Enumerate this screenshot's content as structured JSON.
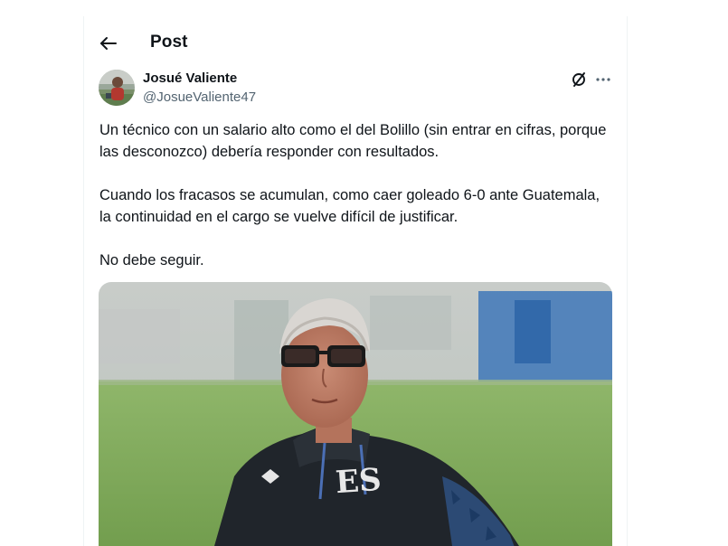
{
  "header": {
    "back_icon": "arrow-left-icon",
    "title": "Post"
  },
  "author": {
    "name": "Josué Valiente",
    "handle": "@JosueValiente47",
    "avatar_icon": "user-avatar"
  },
  "actions": {
    "grok_icon": "grok-icon",
    "more_icon": "more-horizontal-icon"
  },
  "tweet": {
    "paragraphs": [
      "Un técnico con un salario alto como el del Bolillo (sin entrar en cifras, porque las desconozco) debería responder con resultados.",
      "Cuando los fracasos se acumulan, como caer goleado 6-0 ante Guatemala, la continuidad en el cargo se vuelve difícil de justificar.",
      "No debe seguir."
    ]
  },
  "media": {
    "jacket_text": "ES"
  },
  "colors": {
    "text_primary": "#0f1419",
    "text_secondary": "#536471",
    "border": "#eff3f4"
  }
}
